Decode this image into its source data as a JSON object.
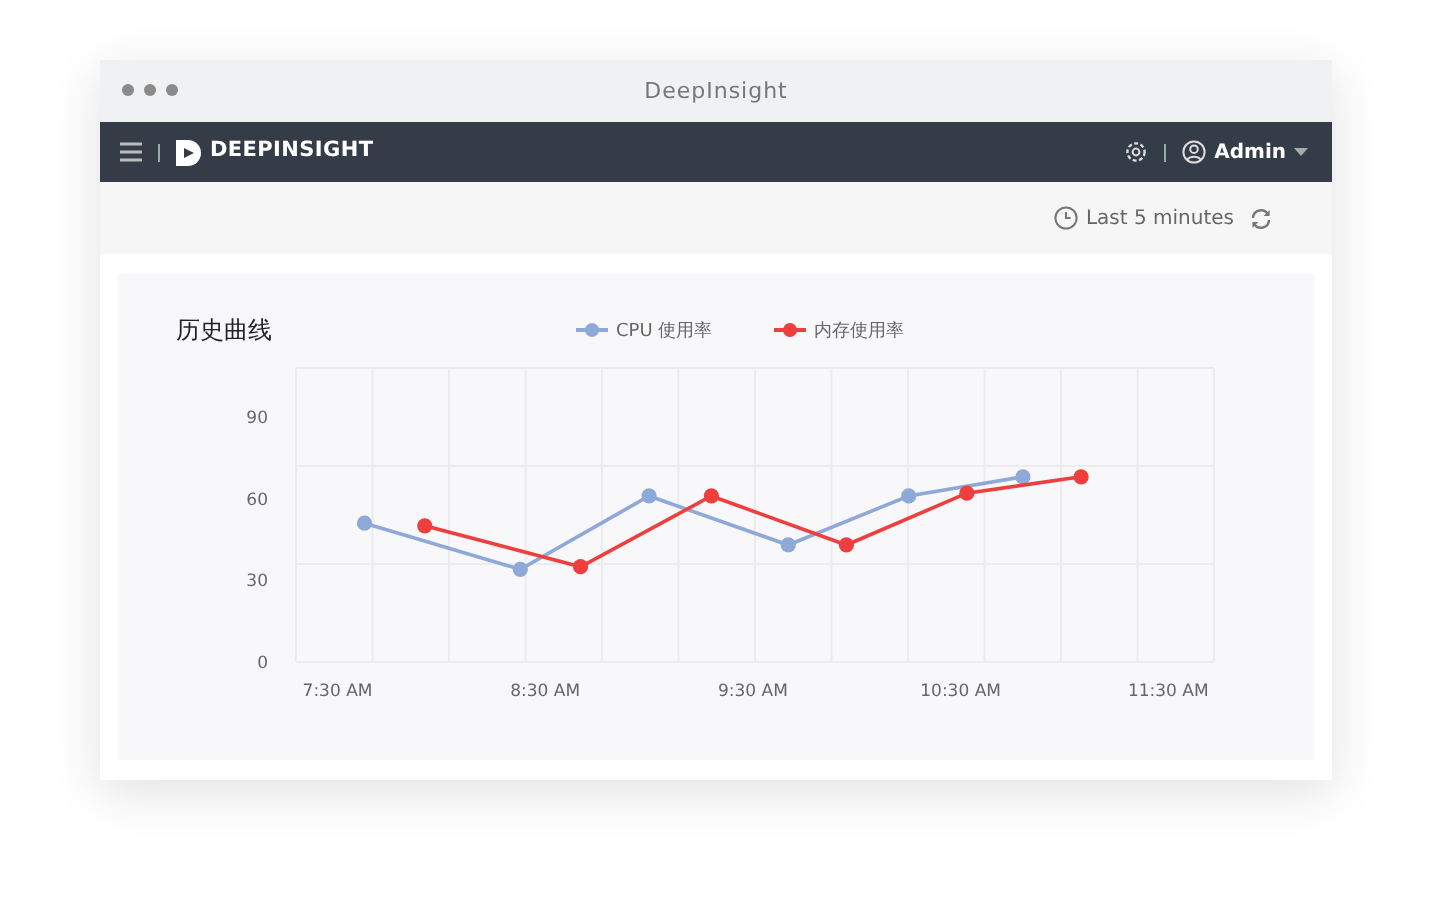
{
  "window": {
    "title": "DeepInsight"
  },
  "navbar": {
    "brand": "DEEPINSIGHT",
    "user": "Admin"
  },
  "toolbar": {
    "time_range": "Last 5 minutes"
  },
  "panel": {
    "title": "历史曲线",
    "chart_data": {
      "type": "line",
      "xlim": [
        7.3,
        11.72
      ],
      "ylim": [
        0,
        108
      ],
      "legend": "top",
      "xticks": [
        {
          "value": 7.5,
          "label": "7:30 AM"
        },
        {
          "value": 8.5,
          "label": "8:30 AM"
        },
        {
          "value": 9.5,
          "label": "9:30 AM"
        },
        {
          "value": 10.5,
          "label": "10:30 AM"
        },
        {
          "value": 11.5,
          "label": "11:30 AM"
        }
      ],
      "yticks": [
        0,
        30,
        60,
        90
      ],
      "series": [
        {
          "name": "CPU 使用率",
          "color": "#8ea8d8",
          "marker": "circle",
          "x": [
            7.63,
            8.38,
            9.0,
            9.67,
            10.25,
            10.8
          ],
          "values": [
            51,
            34,
            61,
            43,
            61,
            68
          ]
        },
        {
          "name": "内存使用率",
          "color": "#ee3e3e",
          "marker": "circle",
          "x": [
            7.92,
            8.67,
            9.3,
            9.95,
            10.53,
            11.08
          ],
          "values": [
            50,
            35,
            61,
            43,
            62,
            68
          ]
        }
      ]
    }
  }
}
